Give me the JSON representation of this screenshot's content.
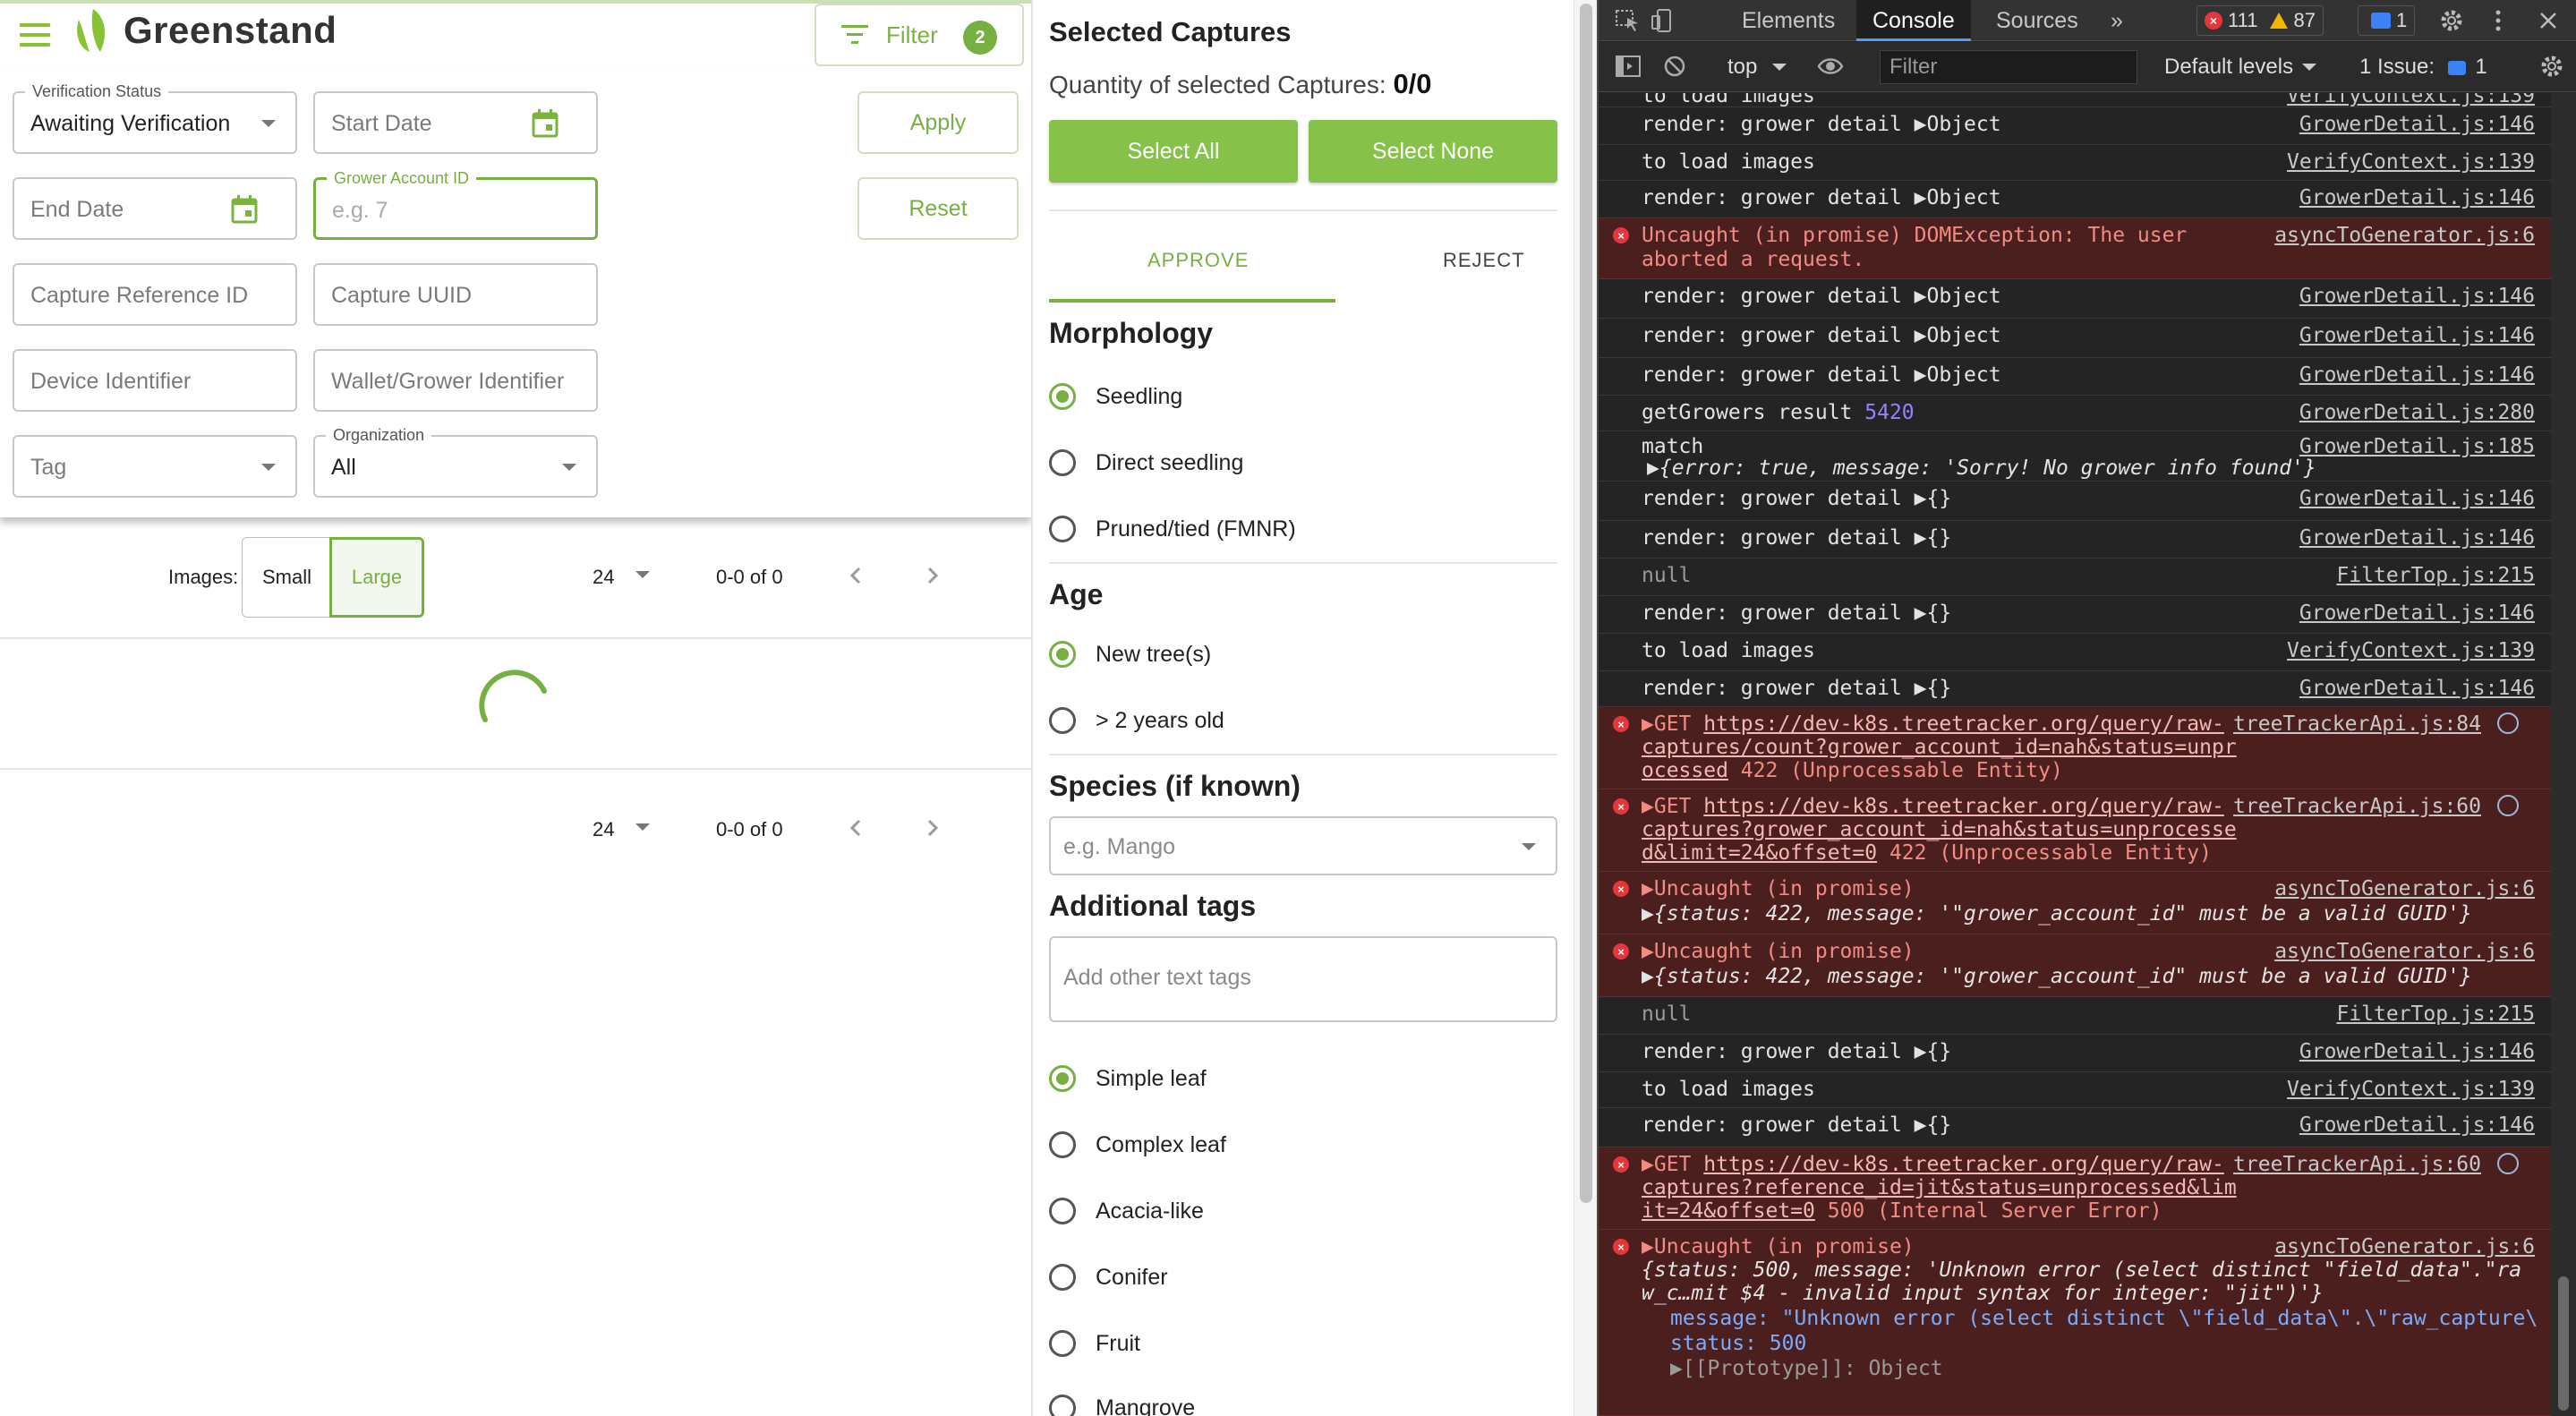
{
  "app": {
    "brand": "Greenstand",
    "filter_button": {
      "label": "Filter",
      "badge": "2"
    },
    "filters": {
      "verification_status": {
        "label": "Verification Status",
        "value": "Awaiting Verification"
      },
      "start_date": {
        "placeholder": "Start Date"
      },
      "end_date": {
        "placeholder": "End Date"
      },
      "grower_account_id": {
        "label": "Grower Account ID",
        "placeholder": "e.g. 7"
      },
      "capture_reference_id": {
        "placeholder": "Capture Reference ID"
      },
      "capture_uuid": {
        "placeholder": "Capture UUID"
      },
      "device_identifier": {
        "placeholder": "Device Identifier"
      },
      "wallet_grower_identifier": {
        "placeholder": "Wallet/Grower Identifier"
      },
      "tag": {
        "placeholder": "Tag"
      },
      "organization": {
        "label": "Organization",
        "value": "All"
      },
      "apply_label": "Apply",
      "reset_label": "Reset"
    },
    "images": {
      "label": "Images:",
      "small": "Small",
      "large": "Large"
    },
    "pagination": {
      "per_page": "24",
      "range": "0-0 of 0"
    },
    "colors": {
      "brand_green": "#76b041",
      "button_green": "#86c24a"
    }
  },
  "sidebar": {
    "title": "Selected Captures",
    "quantity_label": "Quantity of selected Captures:",
    "quantity_value": "0/0",
    "select_all": "Select All",
    "select_none": "Select None",
    "tabs": [
      {
        "label": "APPROVE",
        "active": true
      },
      {
        "label": "REJECT",
        "active": false
      }
    ],
    "morphology": {
      "title": "Morphology",
      "options": [
        {
          "label": "Seedling",
          "checked": true
        },
        {
          "label": "Direct seedling",
          "checked": false
        },
        {
          "label": "Pruned/tied (FMNR)",
          "checked": false
        }
      ]
    },
    "age": {
      "title": "Age",
      "options": [
        {
          "label": "New tree(s)",
          "checked": true
        },
        {
          "label": "> 2 years old",
          "checked": false
        }
      ]
    },
    "species": {
      "title": "Species (if known)",
      "placeholder": "e.g. Mango"
    },
    "additional_tags": {
      "title": "Additional tags",
      "placeholder": "Add other text tags",
      "options": [
        {
          "label": "Simple leaf",
          "checked": true
        },
        {
          "label": "Complex leaf",
          "checked": false
        },
        {
          "label": "Acacia-like",
          "checked": false
        },
        {
          "label": "Conifer",
          "checked": false
        },
        {
          "label": "Fruit",
          "checked": false
        },
        {
          "label": "Mangrove",
          "checked": false
        }
      ]
    }
  },
  "devtools": {
    "tabs": {
      "elements": "Elements",
      "console": "Console",
      "sources": "Sources",
      "more": "»"
    },
    "counts": {
      "errors": "111",
      "warnings": "87",
      "messages": "1"
    },
    "toolbar": {
      "context": "top",
      "filter_placeholder": "Filter",
      "levels": "Default levels",
      "issues": "1 Issue:",
      "issues_count": "1"
    },
    "logs": [
      {
        "text": "to load images",
        "src": "VerifyContext.js:139"
      },
      {
        "text": "render: grower detail ▶Object",
        "src": "GrowerDetail.js:146"
      },
      {
        "text": "to load images",
        "src": "VerifyContext.js:139"
      },
      {
        "text": "render: grower detail ▶Object",
        "src": "GrowerDetail.js:146"
      },
      {
        "text": "Uncaught (in promise) DOMException: The user",
        "text2": "aborted a request.",
        "src": "asyncToGenerator.js:6"
      },
      {
        "text": "render: grower detail ▶Object",
        "src": "GrowerDetail.js:146"
      },
      {
        "text": "render: grower detail ▶Object",
        "src": "GrowerDetail.js:146"
      },
      {
        "text": "render: grower detail ▶Object",
        "src": "GrowerDetail.js:146"
      },
      {
        "text": "getGrowers result ",
        "num": "5420",
        "src": "GrowerDetail.js:280"
      },
      {
        "text": "match",
        "src": "GrowerDetail.js:185"
      },
      {
        "obj": "▶{error: true, message: 'Sorry! No grower info found'}"
      },
      {
        "text": "render: grower detail ▶{}",
        "src": "GrowerDetail.js:146"
      },
      {
        "text": "render: grower detail ▶{}",
        "src": "GrowerDetail.js:146"
      },
      {
        "text": "null",
        "src": "FilterTop.js:215"
      },
      {
        "text": "render: grower detail ▶{}",
        "src": "GrowerDetail.js:146"
      },
      {
        "text": "to load images",
        "src": "VerifyContext.js:139"
      },
      {
        "text": "render: grower detail ▶{}",
        "src": "GrowerDetail.js:146"
      },
      {
        "method": "▶GET ",
        "url1": "https://dev-k8s.treetracker.org/query/raw-",
        "url2": "captures/count?grower_account_id=nah&status=unpr",
        "url3": "ocessed",
        "status": " 422 (Unprocessable Entity)",
        "src": "treeTrackerApi.js:84"
      },
      {
        "method": "▶GET ",
        "url1": "https://dev-k8s.treetracker.org/query/raw-",
        "url2": "captures?grower_account_id=nah&status=unprocesse",
        "url3": "d&limit=24&offset=0",
        "status": " 422 (Unprocessable Entity)",
        "src": "treeTrackerApi.js:60"
      },
      {
        "text": "▶Uncaught (in promise)",
        "obj": "▶{status: 422, message: '\"grower_account_id\" must be a valid GUID'}",
        "src": "asyncToGenerator.js:6"
      },
      {
        "text": "▶Uncaught (in promise)",
        "obj": "▶{status: 422, message: '\"grower_account_id\" must be a valid GUID'}",
        "src": "asyncToGenerator.js:6"
      },
      {
        "text": "null",
        "src": "FilterTop.js:215"
      },
      {
        "text": "render: grower detail ▶{}",
        "src": "GrowerDetail.js:146"
      },
      {
        "text": "to load images",
        "src": "VerifyContext.js:139"
      },
      {
        "text": "render: grower detail ▶{}",
        "src": "GrowerDetail.js:146"
      },
      {
        "method": "▶GET ",
        "url1": "https://dev-k8s.treetracker.org/query/raw-",
        "url2": "captures?reference_id=jit&status=unprocessed&lim",
        "url3": "it=24&offset=0",
        "status": " 500 (Internal Server Error)",
        "src": "treeTrackerApi.js:60"
      },
      {
        "text": "▶Uncaught (in promise)",
        "obj": "{status: 500, message: 'Unknown error (select distinct \"field_data\".\"ra",
        "obj2": "w_c…mit $4 - invalid input syntax for integer: \"jit\")'}",
        "prop1": "message: \"Unknown error (select distinct \\\"field_data\\\".\\\"raw_capture\\",
        "prop2": "status: 500",
        "prop3": "▶[[Prototype]]: Object",
        "src": "asyncToGenerator.js:6"
      }
    ]
  }
}
